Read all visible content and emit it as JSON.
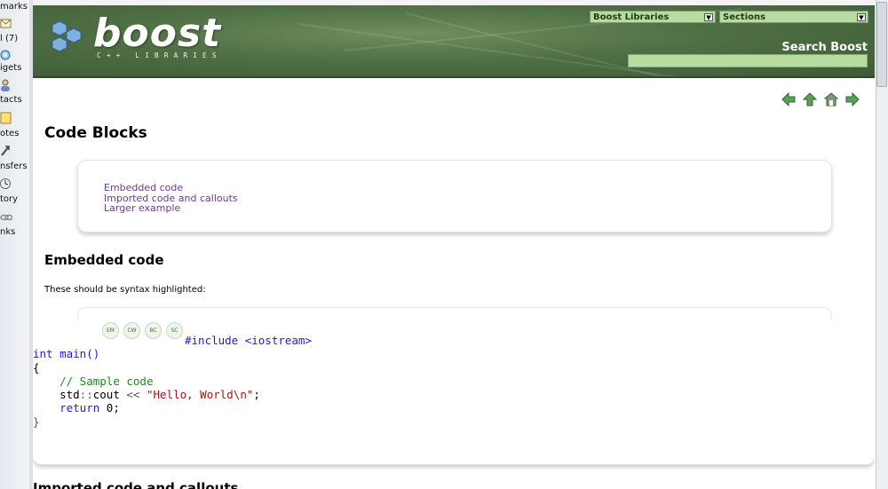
{
  "sidebar": {
    "items": [
      {
        "label": "marks",
        "icon": "bookmarks-icon"
      },
      {
        "label": "l (7)",
        "icon": "mail-icon"
      },
      {
        "label": "igets",
        "icon": "widgets-icon"
      },
      {
        "label": "tacts",
        "icon": "contacts-icon"
      },
      {
        "label": "otes",
        "icon": "notes-icon"
      },
      {
        "label": "nsfers",
        "icon": "transfers-icon"
      },
      {
        "label": "tory",
        "icon": "history-icon"
      },
      {
        "label": "nks",
        "icon": "links-icon"
      }
    ]
  },
  "header": {
    "logo_text": "boost",
    "logo_subtitle": "C++ LIBRARIES",
    "select_libraries": "Boost Libraries",
    "select_sections": "Sections",
    "search_label": "Search Boost",
    "search_value": ""
  },
  "nav": {
    "icons": [
      "prev-arrow-icon",
      "up-arrow-icon",
      "home-icon",
      "next-arrow-icon"
    ]
  },
  "content": {
    "title": "Code Blocks",
    "toc": [
      "Embedded code",
      "Imported code and callouts",
      "Larger example"
    ],
    "section_heading": "Embedded code",
    "intro": "These should be syntax highlighted:",
    "badges": [
      "EM",
      "CW",
      "BC",
      "SC"
    ],
    "next_heading": "Imported code and callouts"
  },
  "code": {
    "line1": "#include <iostream>",
    "line2": "int main()",
    "line3": "{",
    "line4": "// Sample code",
    "line5_a": "std",
    "line5_b": "::",
    "line5_c": "cout",
    "line5_d": " << ",
    "line5_e": "\"Hello, World\\n\"",
    "line5_f": ";",
    "line6_a": "return",
    "line6_b": " 0;",
    "line7": "}"
  },
  "colors": {
    "header_green": "#4f6f45",
    "select_bg": "#b7dba0",
    "link_purple": "#6b3d8e",
    "keyword_blue": "#1f1fc8",
    "comment_green": "#1f8a1f",
    "string_red": "#a31515"
  }
}
